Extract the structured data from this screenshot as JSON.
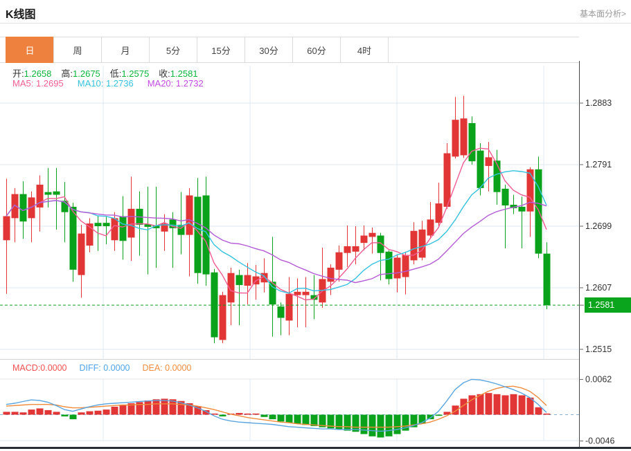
{
  "header": {
    "title": "K线图",
    "analysis_link": "基本面分析>"
  },
  "tabs": {
    "items": [
      {
        "label": "日",
        "active": true
      },
      {
        "label": "周",
        "active": false
      },
      {
        "label": "月",
        "active": false
      },
      {
        "label": "5分",
        "active": false
      },
      {
        "label": "15分",
        "active": false
      },
      {
        "label": "30分",
        "active": false
      },
      {
        "label": "60分",
        "active": false
      },
      {
        "label": "4时",
        "active": false
      }
    ]
  },
  "legend": {
    "open_label": "开:",
    "open": "1.2658",
    "high_label": "高:",
    "high": "1.2675",
    "low_label": "低:",
    "low": "1.2575",
    "close_label": "收:",
    "close": "1.2581",
    "ma5_label": "MA5:",
    "ma5": "1.2695",
    "ma10_label": "MA10:",
    "ma10": "1.2736",
    "ma20_label": "MA20:",
    "ma20": "1.2732"
  },
  "macd_legend": {
    "macd_label": "MACD:",
    "macd": "0.0000",
    "diff_label": "DIFF:",
    "diff": "0.0000",
    "dea_label": "DEA:",
    "dea": "0.0000"
  },
  "price_tag": {
    "value": "1.2581"
  },
  "colors": {
    "up": "#e23535",
    "down": "#0aa21b",
    "ma5": "#f25c93",
    "ma10": "#35c2e0",
    "ma20": "#b45ad6",
    "diff": "#5aa5e0",
    "dea": "#f08c3c",
    "grid": "#dfe9f2",
    "axis": "#444444",
    "zero_dash": "#85b3db",
    "price_dash": "#0aa21b",
    "tag_bg": "#0aa51c",
    "tab_active": "#ef813e",
    "legend_value_green": "#0ab53c"
  },
  "chart_data": {
    "type": "candlestick",
    "title": "K线图 (日)",
    "price_axis_ticks": [
      "1.2883",
      "1.2791",
      "1.2699",
      "1.2607",
      "1.2515"
    ],
    "price_axis_values": [
      1.2883,
      1.2791,
      1.2699,
      1.2607,
      1.2515
    ],
    "last_close": 1.2581,
    "ohlc_last": {
      "open": 1.2658,
      "high": 1.2675,
      "low": 1.2575,
      "close": 1.2581
    },
    "ma_periods": [
      5,
      10,
      20
    ],
    "up_means": "close>open (red)",
    "down_means": "close<open (green)",
    "candles": [
      [
        1.2678,
        1.277,
        1.2598,
        1.2714
      ],
      [
        1.2711,
        1.2756,
        1.2675,
        1.2747
      ],
      [
        1.2747,
        1.2766,
        1.268,
        1.2706
      ],
      [
        1.2711,
        1.2751,
        1.2675,
        1.2742
      ],
      [
        1.2727,
        1.2775,
        1.2691,
        1.2761
      ],
      [
        1.275,
        1.2786,
        1.2727,
        1.2746
      ],
      [
        1.2751,
        1.2786,
        1.2694,
        1.2746
      ],
      [
        1.2737,
        1.2765,
        1.2675,
        1.272
      ],
      [
        1.2728,
        1.2734,
        1.2616,
        1.2634
      ],
      [
        1.2626,
        1.2701,
        1.2592,
        1.2688
      ],
      [
        1.267,
        1.2711,
        1.266,
        1.2703
      ],
      [
        1.2704,
        1.2714,
        1.2662,
        1.2699
      ],
      [
        1.2704,
        1.2714,
        1.2672,
        1.2699
      ],
      [
        1.2678,
        1.272,
        1.2662,
        1.2711
      ],
      [
        1.2714,
        1.2744,
        1.2649,
        1.2677
      ],
      [
        1.2682,
        1.2773,
        1.2647,
        1.2725
      ],
      [
        1.2725,
        1.2751,
        1.2655,
        1.2701
      ],
      [
        1.2702,
        1.2758,
        1.2627,
        1.2698
      ],
      [
        1.27,
        1.2758,
        1.2637,
        1.2696
      ],
      [
        1.2691,
        1.2717,
        1.2662,
        1.2703
      ],
      [
        1.2709,
        1.272,
        1.2637,
        1.2696
      ],
      [
        1.2701,
        1.275,
        1.2657,
        1.2686
      ],
      [
        1.2686,
        1.2756,
        1.2624,
        1.2745
      ],
      [
        1.2743,
        1.2771,
        1.2613,
        1.2629
      ],
      [
        1.2745,
        1.2773,
        1.261,
        1.2627
      ],
      [
        1.263,
        1.2635,
        1.2524,
        1.2533
      ],
      [
        1.2529,
        1.2601,
        1.2524,
        1.2596
      ],
      [
        1.2585,
        1.2637,
        1.2551,
        1.2629
      ],
      [
        1.2626,
        1.2634,
        1.2551,
        1.2611
      ],
      [
        1.261,
        1.2644,
        1.2582,
        1.2626
      ],
      [
        1.2612,
        1.2641,
        1.2589,
        1.2624
      ],
      [
        1.2615,
        1.2651,
        1.26,
        1.2629
      ],
      [
        1.2616,
        1.2683,
        1.2534,
        1.2582
      ],
      [
        1.2579,
        1.2585,
        1.2536,
        1.2562
      ],
      [
        1.2558,
        1.2623,
        1.2536,
        1.2598
      ],
      [
        1.2596,
        1.2621,
        1.2548,
        1.2601
      ],
      [
        1.2596,
        1.2623,
        1.2548,
        1.2601
      ],
      [
        1.2596,
        1.2626,
        1.256,
        1.2589
      ],
      [
        1.2585,
        1.2667,
        1.2577,
        1.262
      ],
      [
        1.2616,
        1.2642,
        1.2596,
        1.2637
      ],
      [
        1.2634,
        1.267,
        1.2616,
        1.266
      ],
      [
        1.2659,
        1.27,
        1.2638,
        1.2669
      ],
      [
        1.2661,
        1.2699,
        1.2642,
        1.2669
      ],
      [
        1.2674,
        1.27,
        1.2663,
        1.2685
      ],
      [
        1.2683,
        1.2697,
        1.2658,
        1.2689
      ],
      [
        1.2685,
        1.2689,
        1.2618,
        1.2659
      ],
      [
        1.2661,
        1.2663,
        1.2612,
        1.262
      ],
      [
        1.2621,
        1.2657,
        1.26,
        1.2652
      ],
      [
        1.2623,
        1.2661,
        1.2597,
        1.2656
      ],
      [
        1.2648,
        1.2705,
        1.2642,
        1.2692
      ],
      [
        1.2652,
        1.2707,
        1.2648,
        1.2694
      ],
      [
        1.2685,
        1.2735,
        1.268,
        1.2709
      ],
      [
        1.2704,
        1.2764,
        1.2697,
        1.2733
      ],
      [
        1.2728,
        1.2823,
        1.2725,
        1.2808
      ],
      [
        1.2803,
        1.2892,
        1.28,
        1.2858
      ],
      [
        1.2805,
        1.2894,
        1.2801,
        1.286
      ],
      [
        1.2853,
        1.2863,
        1.2791,
        1.2796
      ],
      [
        1.2812,
        1.2823,
        1.2745,
        1.2756
      ],
      [
        1.2789,
        1.2825,
        1.2751,
        1.2802
      ],
      [
        1.2797,
        1.2813,
        1.2731,
        1.275
      ],
      [
        1.2755,
        1.2761,
        1.2666,
        1.273
      ],
      [
        1.2731,
        1.2746,
        1.2717,
        1.2726
      ],
      [
        1.2728,
        1.2743,
        1.2666,
        1.2721
      ],
      [
        1.2721,
        1.2787,
        1.2683,
        1.2784
      ],
      [
        1.2784,
        1.2803,
        1.2651,
        1.2658
      ],
      [
        1.2658,
        1.2675,
        1.2575,
        1.2581
      ]
    ],
    "macd": {
      "axis_ticks": [
        "0.0062",
        "-0.0046"
      ],
      "axis_values": [
        0.0062,
        -0.0046
      ],
      "unit": 0.0001,
      "diff": [
        18,
        20,
        23,
        26,
        25,
        22,
        16,
        9,
        6,
        10,
        14,
        17,
        19,
        20,
        21,
        22,
        23,
        24,
        25,
        25,
        24,
        21,
        17,
        12,
        6,
        -2,
        -8,
        -11,
        -13,
        -14,
        -15,
        -16,
        -17,
        -19,
        -21,
        -22,
        -23,
        -24,
        -25,
        -25,
        -26,
        -26,
        -26,
        -27,
        -28,
        -29,
        -28,
        -26,
        -23,
        -19,
        -14,
        -6,
        6,
        24,
        44,
        56,
        62,
        61,
        58,
        54,
        49,
        44,
        38,
        30,
        18,
        4
      ],
      "dea": [
        15,
        16,
        17,
        18,
        18,
        18,
        17,
        14,
        12,
        12,
        13,
        14,
        15,
        16,
        17,
        17,
        18,
        18,
        19,
        19,
        19,
        18,
        17,
        15,
        12,
        9,
        5,
        1,
        -2,
        -5,
        -7,
        -9,
        -11,
        -13,
        -14,
        -16,
        -17,
        -18,
        -19,
        -20,
        -21,
        -21,
        -22,
        -22,
        -22,
        -22,
        -22,
        -21,
        -20,
        -18,
        -16,
        -13,
        -8,
        -2,
        6,
        16,
        26,
        34,
        41,
        46,
        49,
        50,
        47,
        41,
        30,
        16
      ],
      "hist": [
        5,
        5,
        4,
        9,
        11,
        8,
        5,
        -3,
        -8,
        4,
        6,
        7,
        9,
        14,
        17,
        20,
        22,
        25,
        27,
        28,
        27,
        24,
        20,
        15,
        8,
        2,
        -3,
        2,
        3,
        2,
        2,
        -4,
        -8,
        -12,
        -14,
        -16,
        -18,
        -20,
        -22,
        -24,
        -26,
        -28,
        -30,
        -34,
        -38,
        -40,
        -38,
        -34,
        -28,
        -22,
        -16,
        -8,
        -2,
        5,
        16,
        28,
        34,
        36,
        38,
        36,
        34,
        36,
        34,
        30,
        13,
        2
      ]
    }
  }
}
